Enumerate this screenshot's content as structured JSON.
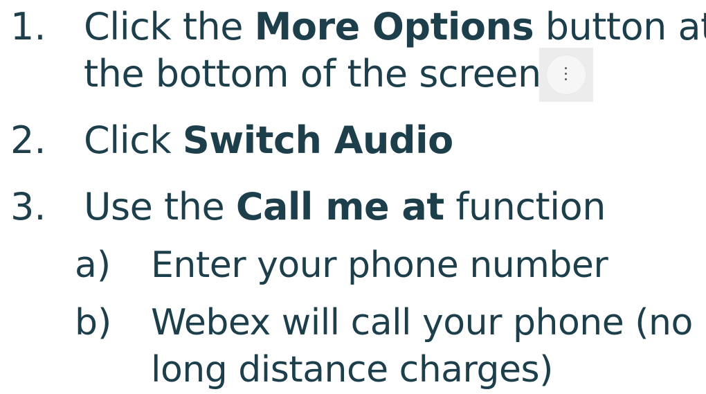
{
  "steps": [
    {
      "number": "1.",
      "text_before": "Click the ",
      "bold": "More Options",
      "text_after": " button at",
      "line2": "the bottom of the screen",
      "icon": "more-vertical-icon"
    },
    {
      "number": "2.",
      "text_before": "Click ",
      "bold": "Switch Audio"
    },
    {
      "number": "3.",
      "text_before": "Use the ",
      "bold": "Call me at",
      "text_after": " function",
      "substeps": [
        {
          "marker": "a)",
          "text": "Enter your phone number"
        },
        {
          "marker": "b)",
          "text": "Webex will call your phone (no",
          "line2": "long distance charges)"
        }
      ]
    }
  ],
  "colors": {
    "text": "#1d3f4c",
    "button_bg": "#ececec"
  }
}
